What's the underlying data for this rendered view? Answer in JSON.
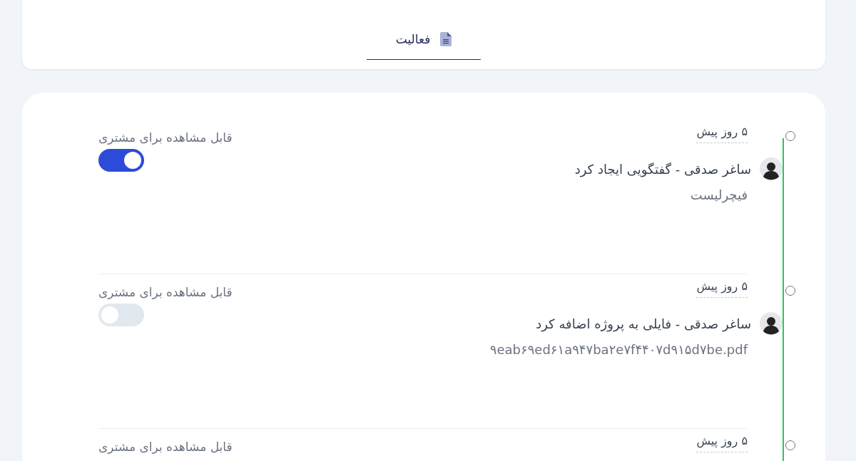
{
  "tabs": [
    {
      "label": "فعالیت",
      "selected": true
    }
  ],
  "activities": [
    {
      "time": "۵ روز پیش",
      "title": "ساغر صدقی - گفتگویی ایجاد کرد",
      "detail": "فیچرلیست",
      "visibility_label": "قابل مشاهده برای مشتری",
      "visible": true
    },
    {
      "time": "۵ روز پیش",
      "title": "ساغر صدقی - فایلی به پروژه اضافه کرد",
      "detail": "۹eab۶۹ed۶۱a۹۴۷ba۲e۷f۴۴۰۷d۹۱۵d۷be.pdf",
      "visibility_label": "قابل مشاهده برای مشتری",
      "visible": false
    },
    {
      "time": "۵ روز پیش",
      "visibility_label": "قابل مشاهده برای مشتری"
    }
  ]
}
